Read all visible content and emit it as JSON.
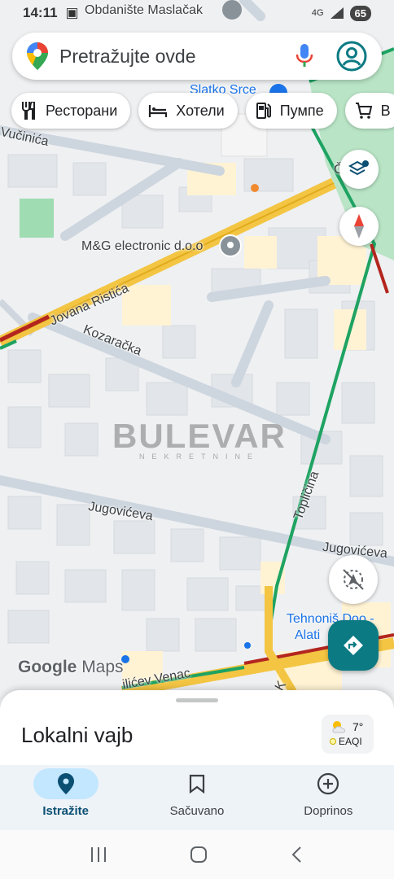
{
  "status_bar": {
    "time": "14:11",
    "network": "4G",
    "battery": "65"
  },
  "search": {
    "placeholder": "Pretražujte ovde"
  },
  "chips": [
    {
      "label": "Ресторани",
      "icon": "restaurant-icon"
    },
    {
      "label": "Хотели",
      "icon": "hotel-icon"
    },
    {
      "label": "Пумпе",
      "icon": "gas-station-icon"
    },
    {
      "label": "B",
      "icon": "shopping-cart-icon"
    }
  ],
  "map": {
    "labels": {
      "kindergarten": "Obdanište Maslačak",
      "slatko_srce": "Slatko Srce",
      "vucinica": "Vučinića",
      "mg_electronic": "M&G electronic d.o.o",
      "jovana_ristica": "Jovana Ristića",
      "kozaracka": "Kozaračka",
      "jugoviceva_west": "Jugovićeva",
      "jugoviceva_east": "Jugovićeva",
      "toplicina": "Topličina",
      "tehnonis_1": "Tehnoniš Doo -",
      "tehnonis_2": "Alati",
      "venac": "ilićev Venac",
      "right_edge": "Č",
      "bottom_k": "K"
    },
    "watermark": {
      "big": "BULEVAR",
      "small": "NEKRETNINE"
    },
    "logo": {
      "google": "Google",
      "maps": "Maps"
    },
    "colors": {
      "park": "#b7e4c7",
      "road_major": "#f3c543",
      "traffic_green": "#1ea362",
      "traffic_red": "#b3261e",
      "road_minor": "#cfd6de",
      "building": "#e3e5e8",
      "block": "#fff4d6"
    }
  },
  "map_controls": {
    "layers_icon": "layers-icon",
    "compass_icon": "compass-icon",
    "location_icon": "location-off-icon",
    "directions_icon": "directions-icon"
  },
  "sheet": {
    "title": "Lokalni vajb",
    "weather": {
      "temperature": "7°",
      "aqi_label": "EAQI"
    }
  },
  "bottom_nav": [
    {
      "label": "Istražite",
      "icon": "explore-pin-icon",
      "active": true
    },
    {
      "label": "Sačuvano",
      "icon": "bookmark-icon",
      "active": false
    },
    {
      "label": "Doprinos",
      "icon": "add-circle-icon",
      "active": false
    }
  ]
}
